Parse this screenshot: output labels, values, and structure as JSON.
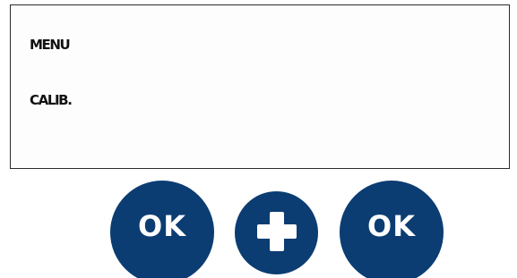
{
  "display": {
    "lines": [
      "MENU",
      "CALIB."
    ]
  },
  "buttons": {
    "ok_left_label": "OK",
    "plus_icon": "plus-icon",
    "ok_right_label": "OK"
  },
  "colors": {
    "button_fill": "#0b3d72",
    "button_text": "#ffffff",
    "display_border": "#2b2b2b",
    "display_text": "#111111"
  }
}
